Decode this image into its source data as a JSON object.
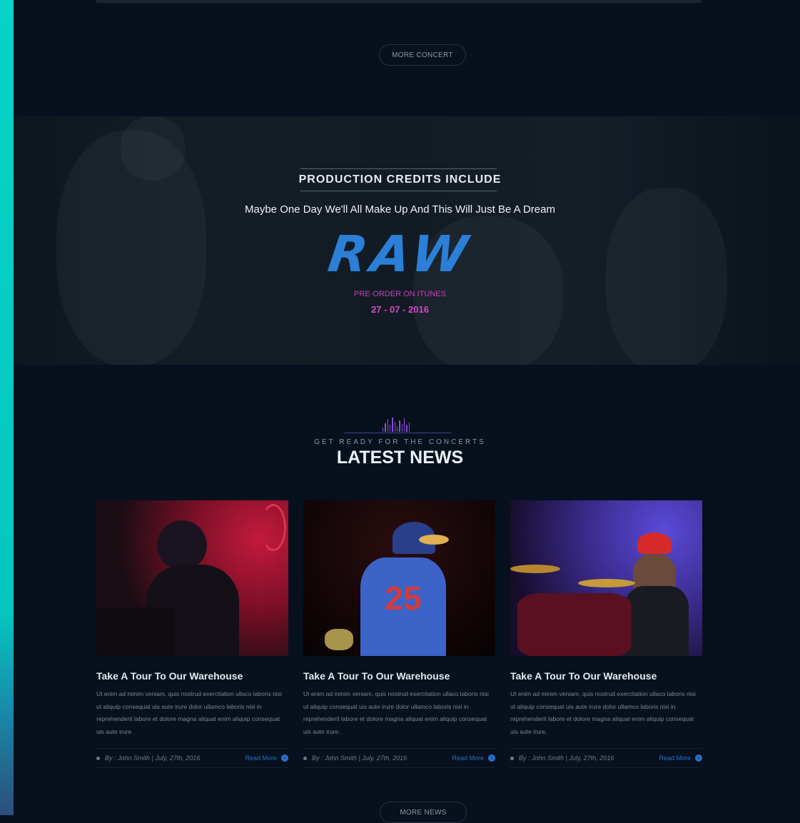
{
  "buttons": {
    "more_concert": "MORE CONCERT",
    "more_news": "MORE NEWS"
  },
  "credits": {
    "title": "PRODUCTION CREDITS INCLUDE",
    "subtitle": "Maybe One Day We'll All Make Up And This Will Just Be A Dream",
    "logo_text": "RAW",
    "preorder": "PRE-ORDER ON ITUNES",
    "date": "27 - 07 - 2016"
  },
  "news": {
    "eyebrow": "GET READY FOR THE CONCERTS",
    "title": "LATEST NEWS",
    "cards": [
      {
        "headline": "Take A Tour To Our Warehouse",
        "body": "Ut enim ad minim veniam, quis nostrud exercitation ullaco laboris nisi ut aliquip consequat uis aute irure dolor ullamco laboris nisi in reprehenderit labore et dolore magna aliquat enim aliquip consequat uis aute irure.",
        "meta": "By : John Smith  |  July, 27th, 2016",
        "read_more": "Read More"
      },
      {
        "headline": "Take A Tour To Our Warehouse",
        "body": "Ut enim ad minim veniam, quis nostrud exercitation ullaco laboris nisi ut aliquip consequat uis aute irure dolor ullamco laboris nisi in reprehenderit labore et dolore magna aliquat enim aliquip consequat uis aute irure.",
        "meta": "By : John Smith  |  July, 27th, 2016",
        "read_more": "Read More"
      },
      {
        "headline": "Take A Tour To Our Warehouse",
        "body": "Ut enim ad minim veniam, quis nostrud exercitation ullaco laboris nisi ut aliquip consequat uis aute irure dolor ullamco laboris nisi in reprehenderit labore et dolore magna aliquat enim aliquip consequat uis aute irure.",
        "meta": "By : John Smith  |  July, 27th, 2016",
        "read_more": "Read More"
      }
    ]
  },
  "colors": {
    "background": "#06111d",
    "accent_teal": "#08d3c6",
    "accent_blue": "#2b7fd6",
    "accent_magenta": "#d24ac6"
  }
}
